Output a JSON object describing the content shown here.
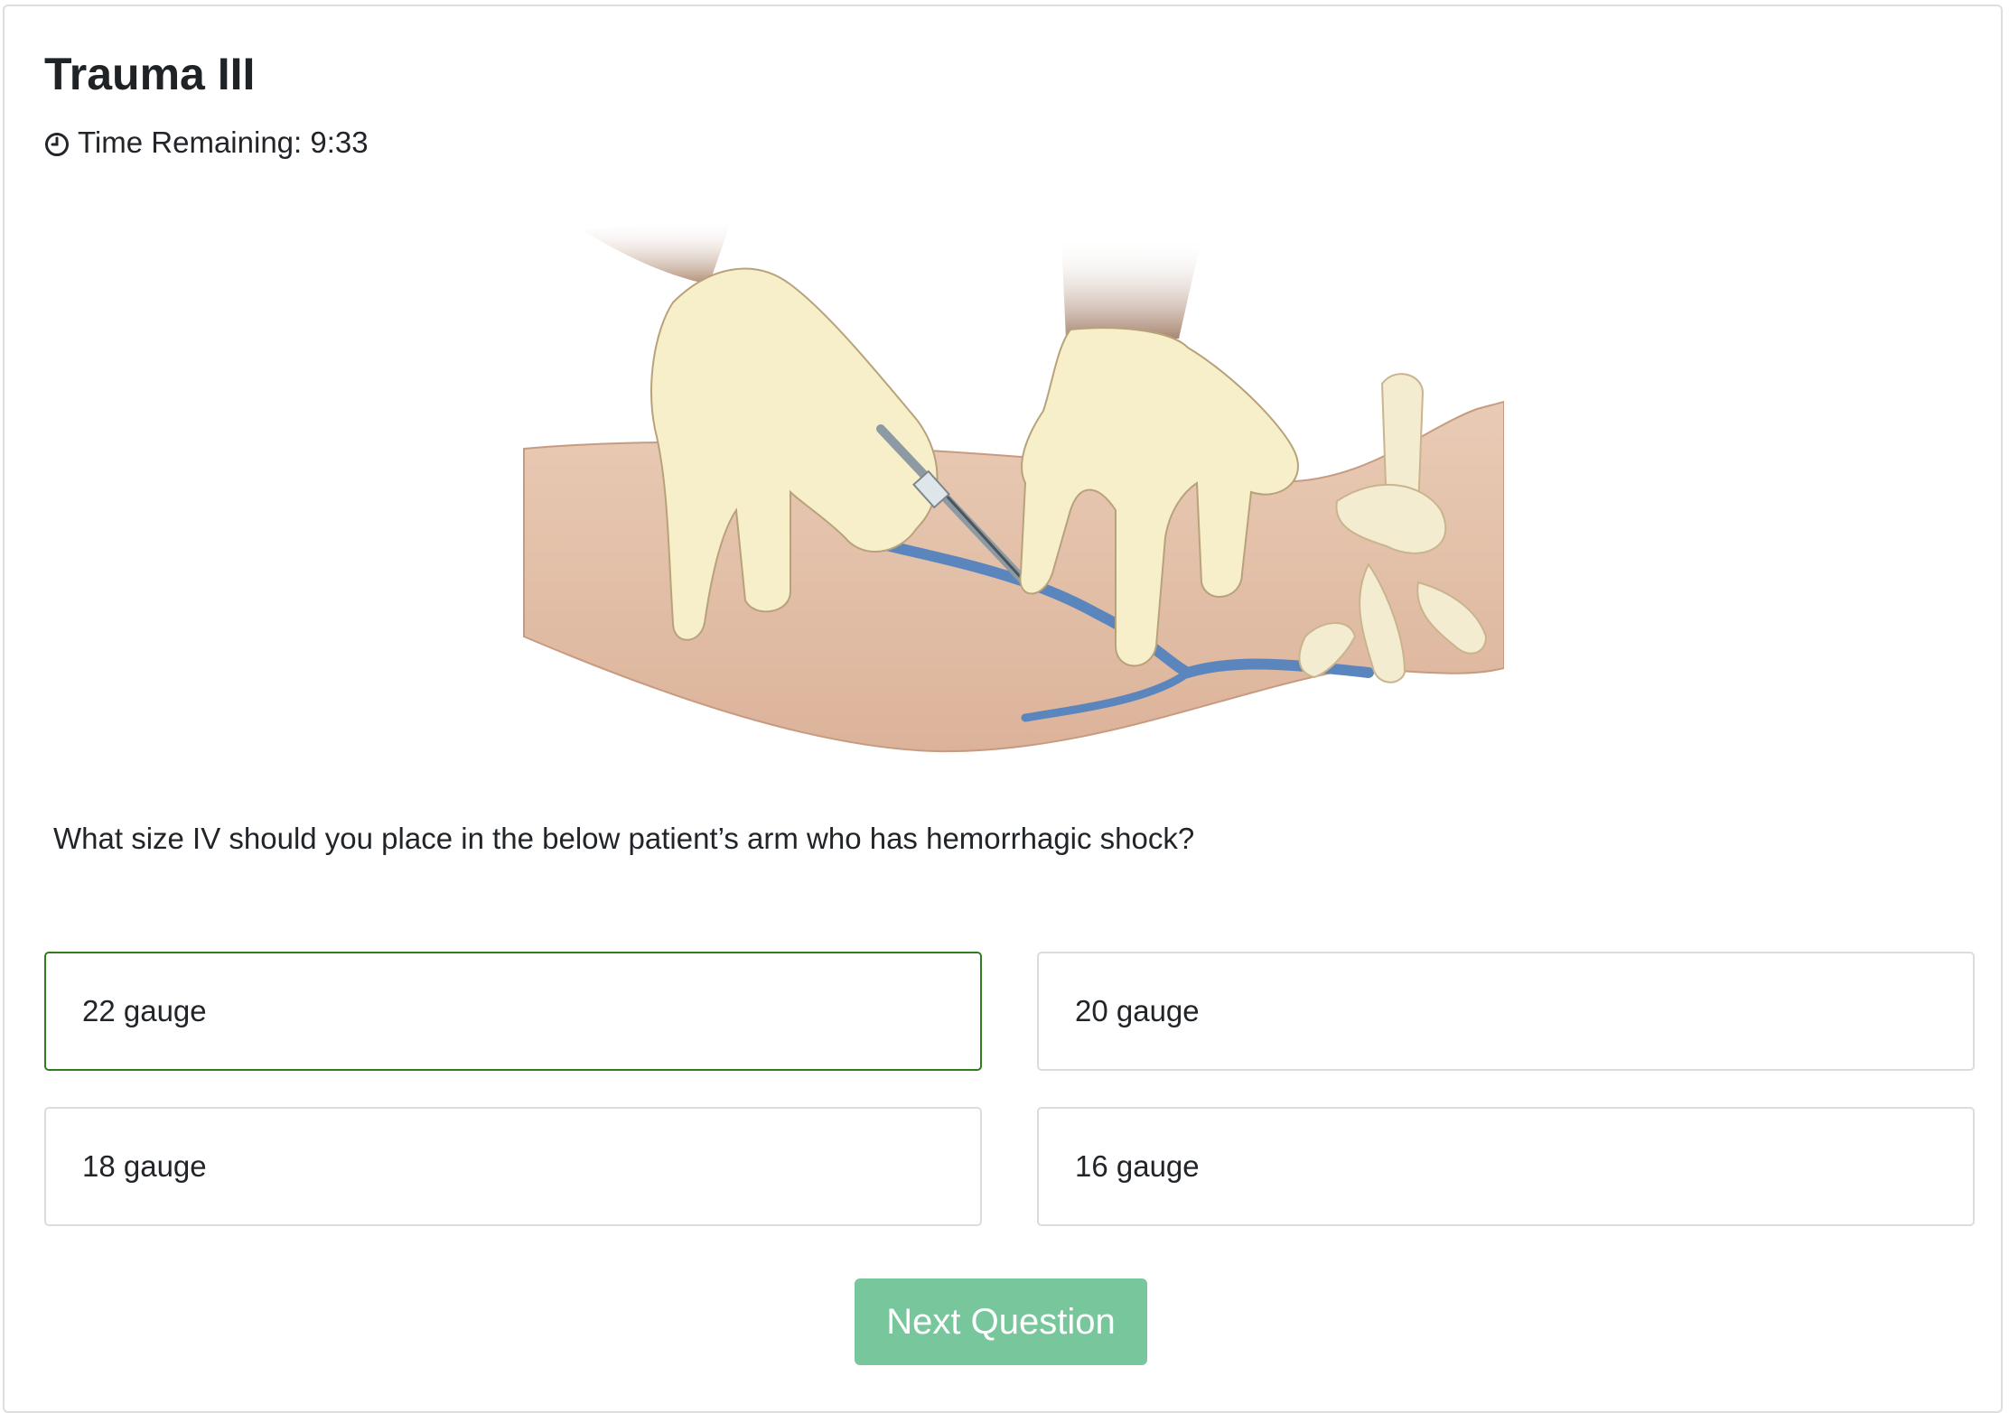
{
  "quiz": {
    "title": "Trauma III",
    "timer_icon": "clock-icon",
    "timer_text": "Time Remaining: 9:33",
    "question": "What size IV should you place in the below patient’s arm who has hemorrhagic shock?",
    "answers": [
      {
        "label": "22 gauge",
        "selected": true
      },
      {
        "label": "20 gauge",
        "selected": false
      },
      {
        "label": "18 gauge",
        "selected": false
      },
      {
        "label": "16 gauge",
        "selected": false
      }
    ],
    "next_label": "Next Question"
  },
  "colors": {
    "selected_border": "#2f7d1f",
    "button_bg": "#78c79c",
    "vein": "#5b86bd",
    "skin": "#e6c4ad",
    "glove": "#f7efc9"
  }
}
